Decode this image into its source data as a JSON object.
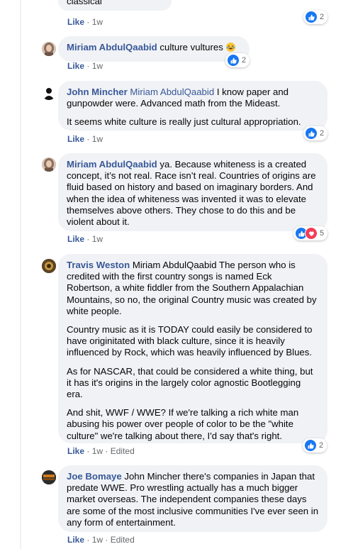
{
  "comments": [
    {
      "text_paragraphs": [
        "classical"
      ],
      "meta": {
        "like": "Like",
        "time": "1w"
      },
      "reactions": {
        "count": "2"
      }
    },
    {
      "author": "Miriam AbdulQaabid",
      "text": "culture vultures",
      "emoji": "laughing-emoji",
      "meta": {
        "like": "Like",
        "time": "1w"
      },
      "reactions": {
        "count": "2"
      }
    },
    {
      "author": "John Mincher",
      "mention": "Miriam AbdulQaabid",
      "first_text": "I know paper and gunpowder were. Advanced math from the Mideast.",
      "second_text": "It seems white culture is really just cultural appropriation.",
      "meta": {
        "like": "Like",
        "time": "1w"
      },
      "reactions": {
        "count": "2"
      }
    },
    {
      "author": "Miriam AbdulQaabid",
      "text": "ya. Because whiteness is a created concept, it’s not real. Race isn’t real. Countries of origins are fluid based on history and based on imaginary borders. And when the idea of whiteness was invented it was to elevate themselves above others. They chose to do this and be violent about it.",
      "meta": {
        "like": "Like",
        "time": "1w"
      },
      "reactions": {
        "count": "5"
      }
    },
    {
      "author": "Travis Weston",
      "first_text": "Miriam AbdulQaabid The person who is credited with the first country songs is named Eck Robertson, a white fiddler from the Southern Appalachian Mountains, so no, the original Country music was created by white people.",
      "p2": "Country music as it is TODAY could easily be considered to have originitated with black culture, since it is heavily influenced by Rock, which was heavily influenced by Blues.",
      "p3": "As for NASCAR, that could be considered a white thing, but it has it's origins in the largely color agnostic Bootlegging era.",
      "p4": "And shit, WWF / WWE? If we're talking a rich white man abusing his power over people of color to be the \"white culture\" we're talking about there, I'd say that's right.",
      "meta": {
        "like": "Like",
        "time": "1w",
        "edited": "Edited"
      },
      "reactions": {
        "count": "2"
      }
    },
    {
      "author": "Joe Bomaye",
      "text": "John Mincher there's companies in Japan that predate WWE. Pro wrestling actually has a much bigger market overseas. The independent companies these days are some of the most inclusive communities I've ever seen in any form of entertainment.",
      "meta": {
        "like": "Like",
        "time": "1w",
        "edited": "Edited"
      }
    }
  ],
  "separator": "·"
}
